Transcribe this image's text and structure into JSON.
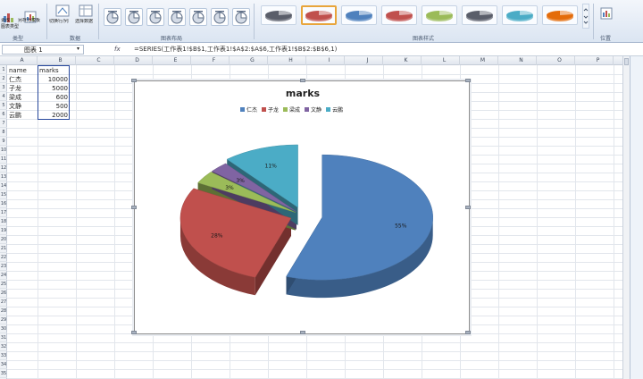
{
  "ribbon": {
    "left_btn1_label": "更改\n图表类型",
    "left_btn2_label": "另存为模板",
    "left_group_label": "类型",
    "data_group": {
      "switch_label": "切换行/列",
      "select_label": "选择数据",
      "group_label": "数据"
    },
    "layouts_group_label": "图表布局",
    "styles_group_label": "图表样式",
    "move_chart_label": "移动图表",
    "location_group_label": "位置",
    "style_colors": [
      "#5a5e6a",
      "#c0504d",
      "#4f81bd",
      "#c0504d",
      "#9bbb59",
      "#5a5e6a",
      "#4bacc6",
      "#e46c0a"
    ]
  },
  "formula_bar": {
    "name_box": "图表 1",
    "formula": "=SERIES(工作表1!$B$1,工作表1!$A$2:$A$6,工作表1!$B$2:$B$6,1)"
  },
  "sheet": {
    "columns": [
      "A",
      "B",
      "C",
      "D",
      "E",
      "F",
      "G",
      "H",
      "I",
      "J",
      "K",
      "L",
      "M",
      "N",
      "O",
      "P"
    ],
    "rows": [
      "1",
      "2",
      "3",
      "4",
      "5",
      "6",
      "7",
      "8",
      "9",
      "10",
      "11",
      "12",
      "13",
      "14",
      "15",
      "16",
      "17",
      "18",
      "19",
      "20",
      "21",
      "22",
      "23",
      "24",
      "25",
      "26",
      "27",
      "28",
      "29",
      "30",
      "31",
      "32",
      "33",
      "34",
      "35"
    ],
    "table": [
      {
        "name": "name",
        "marks": "marks"
      },
      {
        "name": "仁杰",
        "marks": "10000"
      },
      {
        "name": "子龙",
        "marks": "5000"
      },
      {
        "name": "梁成",
        "marks": "600"
      },
      {
        "name": "文静",
        "marks": "500"
      },
      {
        "name": "云鹏",
        "marks": "2000"
      }
    ]
  },
  "chart_data": {
    "type": "pie",
    "title": "marks",
    "categories": [
      "仁杰",
      "子龙",
      "梁成",
      "文静",
      "云鹏"
    ],
    "values": [
      10000,
      5000,
      600,
      500,
      2000
    ],
    "labels": [
      "55%",
      "28%",
      "3%",
      "3%",
      "11%"
    ],
    "colors": [
      "#4f81bd",
      "#c0504d",
      "#9bbb59",
      "#8064a2",
      "#4bacc6"
    ],
    "legend_position": "top",
    "exploded": true
  }
}
